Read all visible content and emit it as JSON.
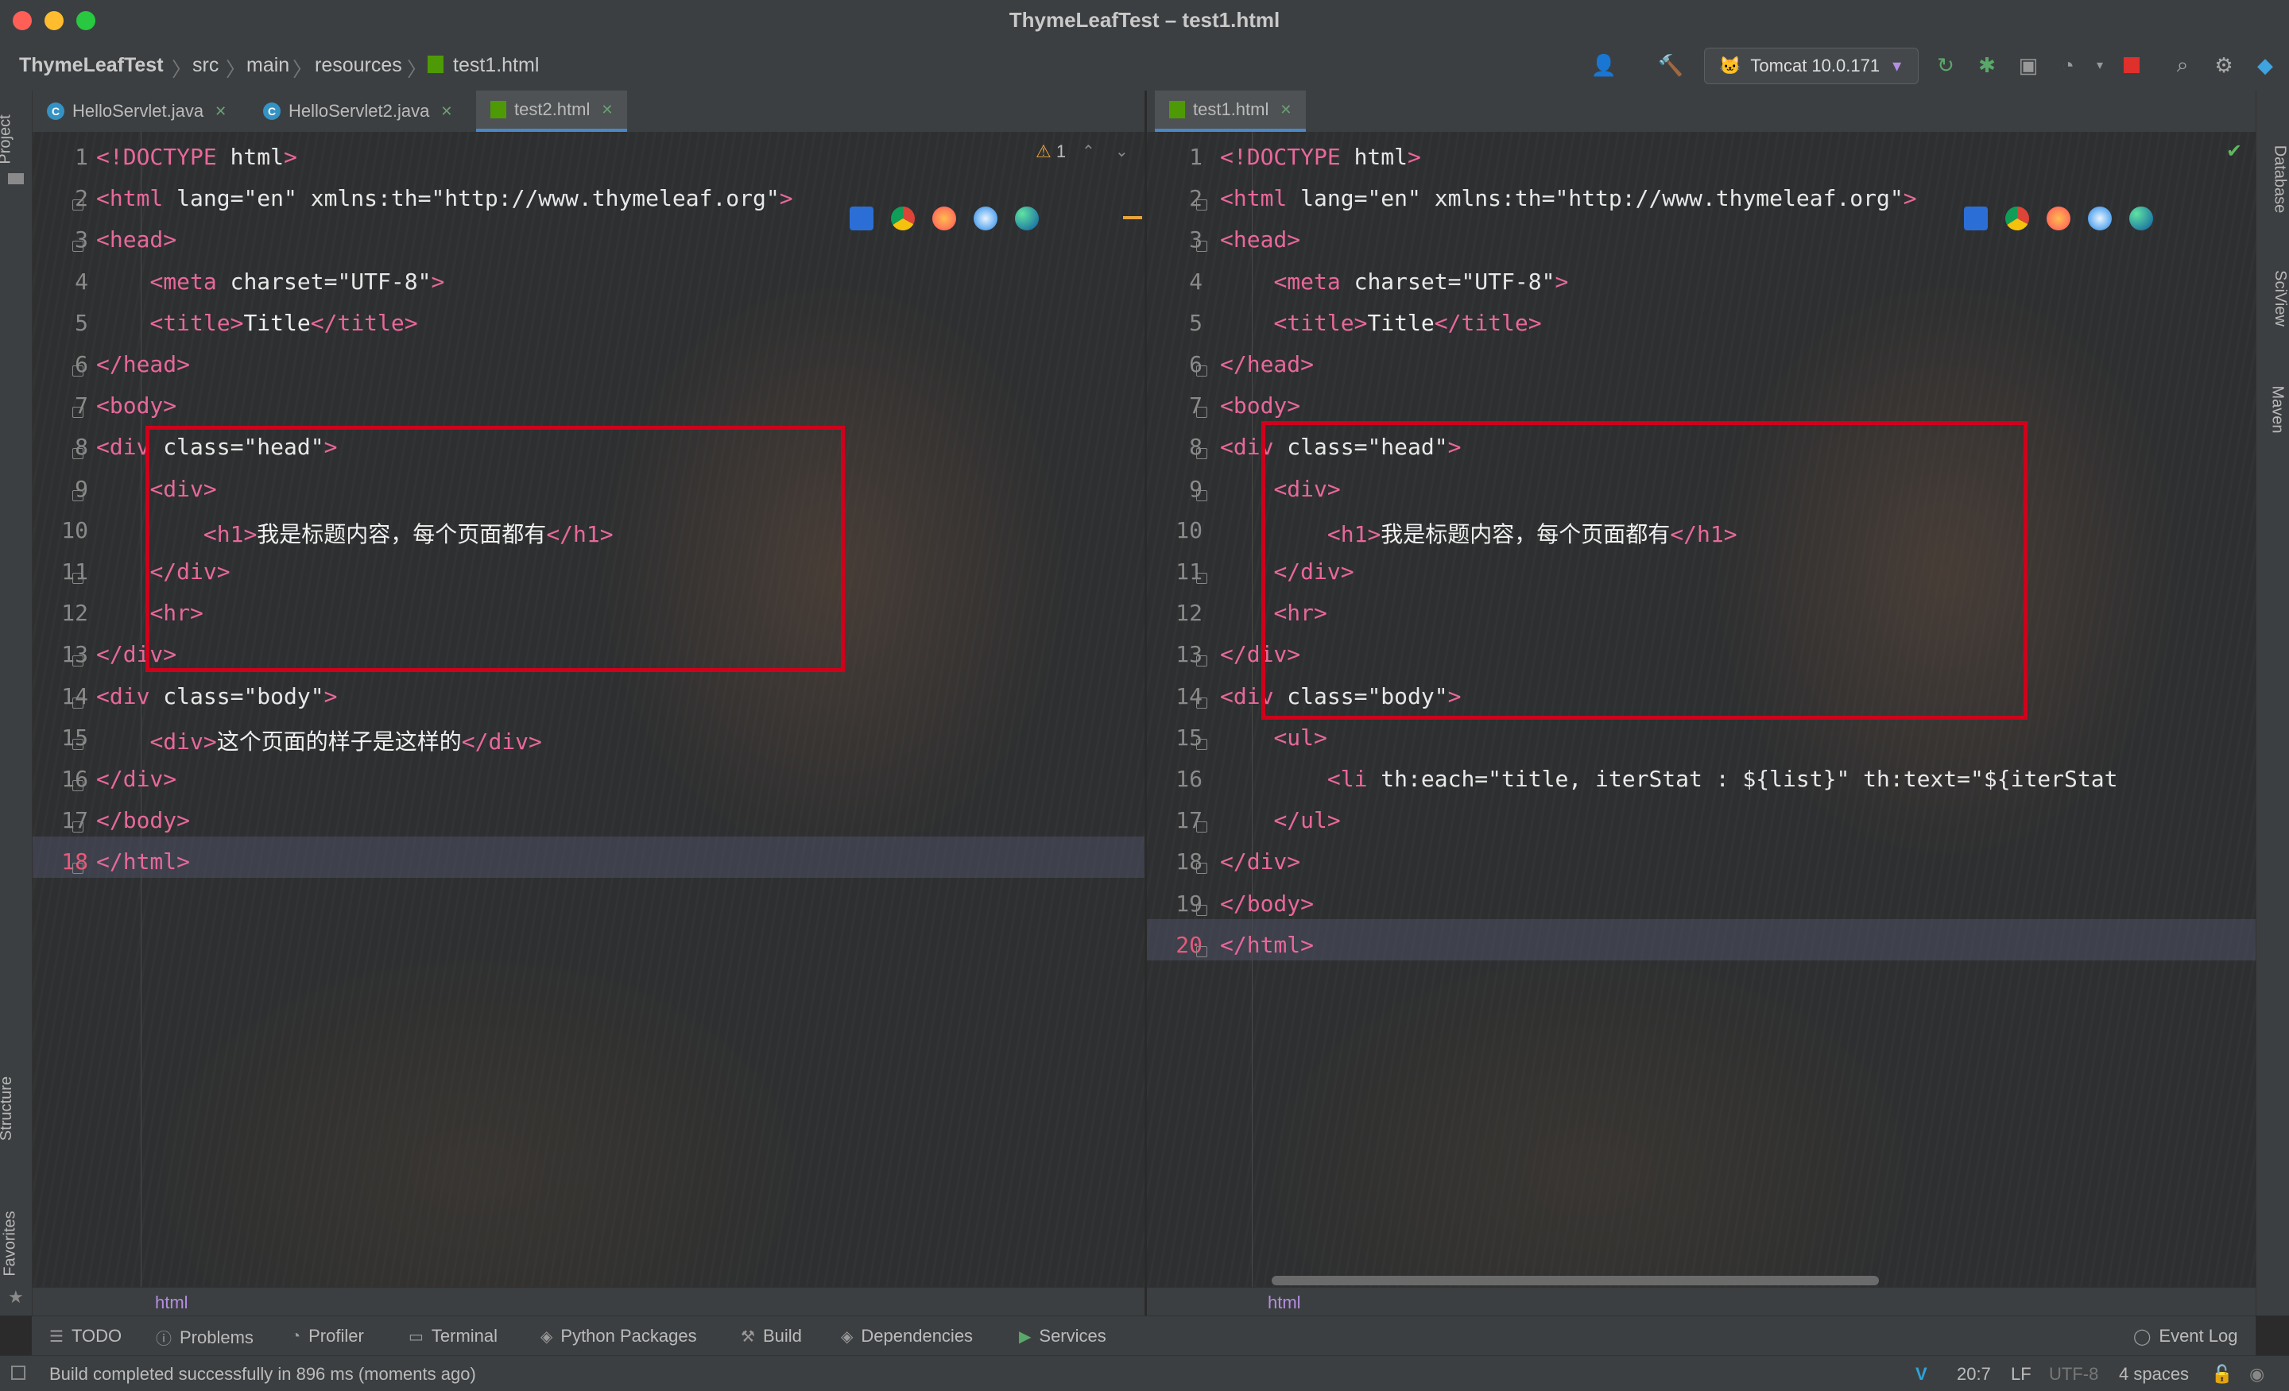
{
  "window": {
    "title": "ThymeLeafTest – test1.html"
  },
  "breadcrumbs": [
    "ThymeLeafTest",
    "src",
    "main",
    "resources",
    "test1.html"
  ],
  "toolbar": {
    "run_config": "Tomcat 10.0.171"
  },
  "left_stripe": {
    "project": "Project",
    "structure": "Structure",
    "favorites": "Favorites"
  },
  "right_stripe": {
    "database": "Database",
    "sciview": "SciView",
    "maven": "Maven"
  },
  "left_tabs": [
    {
      "label": "HelloServlet.java",
      "type": "java",
      "active": false
    },
    {
      "label": "HelloServlet2.java",
      "type": "java",
      "active": false
    },
    {
      "label": "test2.html",
      "type": "html",
      "active": true
    }
  ],
  "right_tabs": [
    {
      "label": "test1.html",
      "type": "html",
      "active": true
    }
  ],
  "left_editor": {
    "warnings": "1",
    "current_line": "18",
    "line_numbers": [
      "1",
      "2",
      "3",
      "4",
      "5",
      "6",
      "7",
      "8",
      "9",
      "10",
      "11",
      "12",
      "13",
      "14",
      "15",
      "16",
      "17",
      "18"
    ],
    "breadcrumb": "html",
    "lines": [
      "<!DOCTYPE html>",
      "<html lang=\"en\" xmlns:th=\"http://www.thymeleaf.org\">",
      "<head>",
      "    <meta charset=\"UTF-8\">",
      "    <title>Title</title>",
      "</head>",
      "<body>",
      "<div class=\"head\">",
      "    <div>",
      "        <h1>我是标题内容，每个页面都有</h1>",
      "    </div>",
      "    <hr>",
      "</div>",
      "<div class=\"body\">",
      "    <div>这个页面的样子是这样的</div>",
      "</div>",
      "</body>",
      "</html>"
    ]
  },
  "right_editor": {
    "current_line": "20",
    "line_numbers": [
      "1",
      "2",
      "3",
      "4",
      "5",
      "6",
      "7",
      "8",
      "9",
      "10",
      "11",
      "12",
      "13",
      "14",
      "15",
      "16",
      "17",
      "18",
      "19",
      "20"
    ],
    "breadcrumb": "html",
    "lines": [
      "<!DOCTYPE html>",
      "<html lang=\"en\" xmlns:th=\"http://www.thymeleaf.org\">",
      "<head>",
      "    <meta charset=\"UTF-8\">",
      "    <title>Title</title>",
      "</head>",
      "<body>",
      "<div class=\"head\">",
      "    <div>",
      "        <h1>我是标题内容，每个页面都有</h1>",
      "    </div>",
      "    <hr>",
      "</div>",
      "<div class=\"body\">",
      "    <ul>",
      "        <li th:each=\"title, iterStat : ${list}\" th:text=\"${iterStat",
      "    </ul>",
      "</div>",
      "</body>",
      "</html>"
    ]
  },
  "tool_windows": [
    "TODO",
    "Problems",
    "Profiler",
    "Terminal",
    "Python Packages",
    "Build",
    "Dependencies",
    "Services"
  ],
  "event_log": "Event Log",
  "status": {
    "message": "Build completed successfully in 896 ms (moments ago)",
    "position": "20:7",
    "line_sep": "LF",
    "encoding": "UTF-8",
    "indent": "4 spaces"
  },
  "colors": {
    "tag": "#e8689a",
    "attr": "#9bd47a",
    "highlight_box": "#d0021b",
    "tab_underline": "#4a88c7"
  }
}
